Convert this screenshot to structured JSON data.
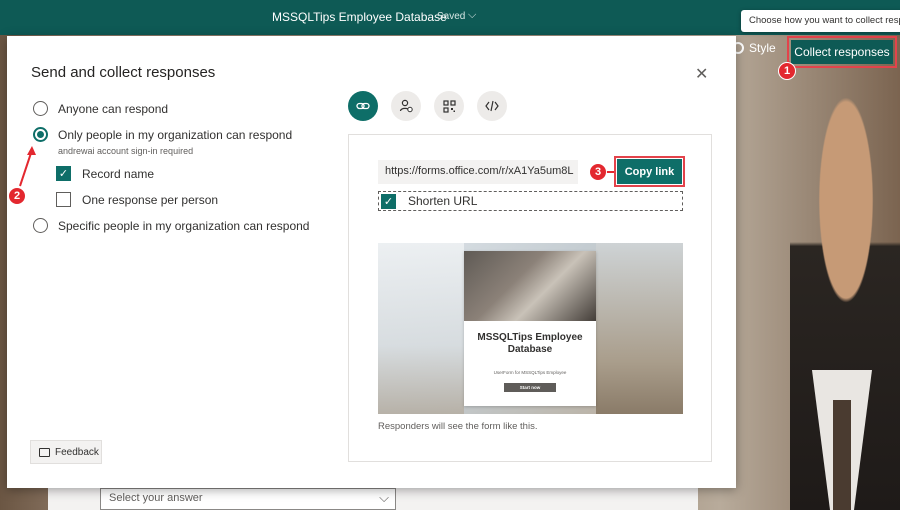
{
  "app": {
    "title": "MSSQLTips Employee Database",
    "saved": "Saved",
    "saved_chevron": "⌵"
  },
  "toolbar": {
    "style_label": "Style",
    "collect_label": "Collect responses"
  },
  "tooltip": {
    "text": "Choose how you want to collect responses"
  },
  "background_form": {
    "select_placeholder": "Select your answer",
    "select_chevron": "⌵"
  },
  "dialog": {
    "title": "Send and collect responses",
    "close": "✕",
    "options": [
      {
        "label": "Anyone can respond",
        "selected": false
      },
      {
        "label": "Only people in my organization can respond",
        "selected": true,
        "note": "andrewai account sign-in required"
      },
      {
        "label": "Specific people in my organization can respond",
        "selected": false
      }
    ],
    "checks": [
      {
        "label": "Record name",
        "checked": true
      },
      {
        "label": "One response per person",
        "checked": false
      }
    ],
    "check_mark": "✓",
    "feedback_label": "Feedback",
    "tabs": [
      {
        "icon": "link-icon",
        "active": true
      },
      {
        "icon": "people-invite-icon",
        "active": false
      },
      {
        "icon": "qr-code-icon",
        "active": false
      },
      {
        "icon": "embed-code-icon",
        "active": false
      }
    ],
    "share": {
      "url": "https://forms.office.com/r/xA1Ya5um8L",
      "copy_label": "Copy link",
      "shorten_label": "Shorten URL",
      "shorten_checked": true,
      "preview_title": "MSSQLTips Employee Database",
      "preview_subtitle": "UserForm for MSSQLTips Employee",
      "preview_button": "Start now",
      "caption": "Responders will see the form like this."
    }
  },
  "annotations": [
    {
      "number": "1"
    },
    {
      "number": "2"
    },
    {
      "number": "3"
    }
  ],
  "colors": {
    "accent": "#0e6e68",
    "header": "#0e5a55",
    "highlight": "#e3434b",
    "badge": "#e3282f"
  }
}
